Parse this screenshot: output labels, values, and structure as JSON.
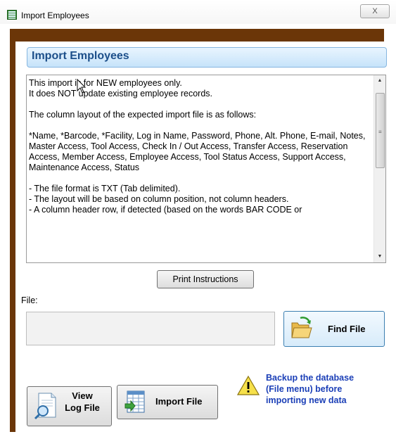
{
  "window": {
    "title": "Import Employees",
    "close_label": "X"
  },
  "panel": {
    "header": "Import Employees"
  },
  "instructions": {
    "text": "This import is for NEW employees only.\nIt does NOT update existing employee records.\n\nThe column layout of the expected import file is as follows:\n\n*Name, *Barcode, *Facility, Log in Name, Password, Phone, Alt. Phone, E-mail, Notes, Master Access, Tool Access, Check In / Out Access, Transfer Access, Reservation Access, Member Access, Employee Access, Tool Status Access, Support Access, Maintenance Access, Status\n\n- The file format is TXT (Tab delimited).\n- The layout will be based on column position, not column headers.\n- A column header row, if detected (based on the words BAR CODE or"
  },
  "buttons": {
    "print": "Print Instructions",
    "find_file": "Find File",
    "view_log_line1": "View",
    "view_log_line2": "Log File",
    "import_file": "Import File"
  },
  "file": {
    "label": "File:",
    "value": ""
  },
  "warning": {
    "line1": "Backup the database",
    "line2": "(File menu) before",
    "line3": "importing new data"
  },
  "icons": {
    "app": "employee-import-icon",
    "folder": "folder-open-icon",
    "warning": "warning-icon",
    "view_log": "document-search-icon",
    "import": "spreadsheet-import-icon"
  },
  "colors": {
    "frame": "#6b3608",
    "header_text": "#1c4f8a",
    "warning_text": "#1b3fb7"
  }
}
